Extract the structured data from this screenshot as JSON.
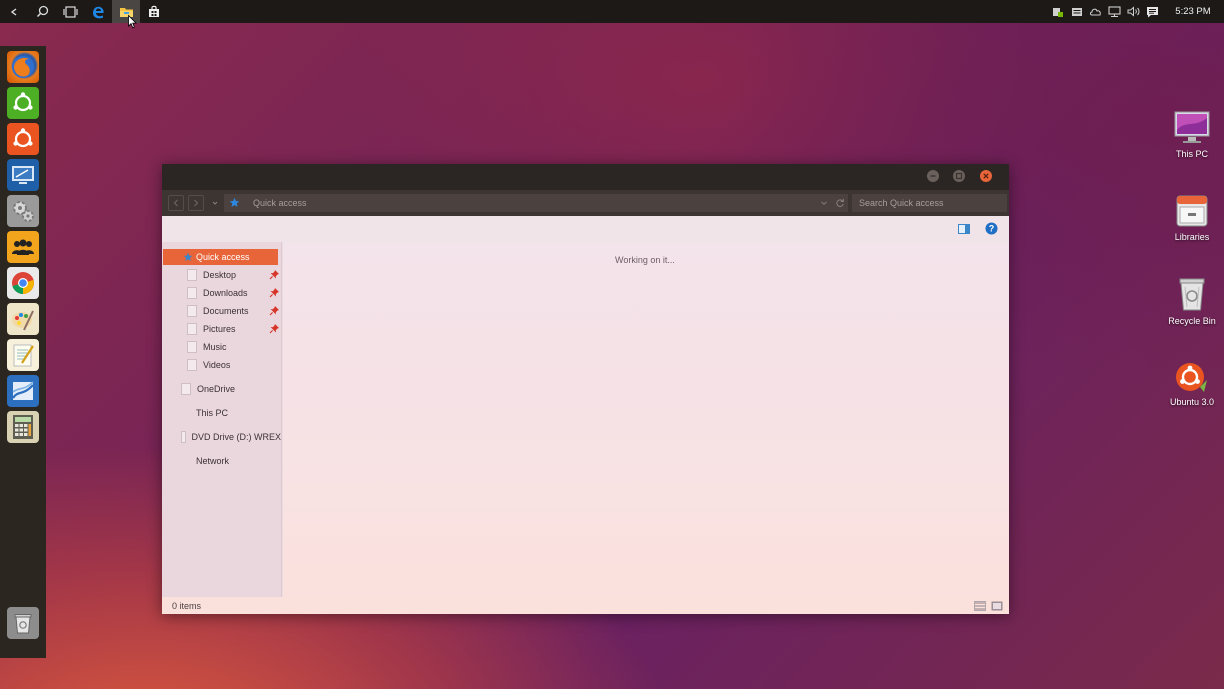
{
  "taskbar": {
    "clock": "5:23 PM",
    "buttons": [
      "back-icon",
      "search-icon",
      "task-view-icon",
      "edge-icon",
      "file-explorer-icon",
      "store-icon"
    ],
    "tray": [
      "nvidia-icon",
      "keyboard-icon",
      "onedrive-icon",
      "network-icon",
      "volume-icon",
      "action-center-icon"
    ]
  },
  "launcher": {
    "apps": [
      "firefox-icon",
      "ubuntu-software-icon",
      "ubuntu-icon",
      "remote-desktop-icon",
      "settings-icon",
      "people-icon",
      "chrome-icon",
      "paint-icon",
      "notepad-icon",
      "sheets-icon",
      "calculator-icon"
    ],
    "trash": "trash-icon"
  },
  "desktop": {
    "icons": [
      {
        "label": "This PC",
        "icon": "monitor-icon"
      },
      {
        "label": "Libraries",
        "icon": "libraries-icon"
      },
      {
        "label": "Recycle Bin",
        "icon": "recycle-bin-icon"
      },
      {
        "label": "Ubuntu 3.0",
        "icon": "ubuntu-logo-icon"
      }
    ]
  },
  "explorer": {
    "address": "Quick access",
    "search_placeholder": "Search Quick access",
    "nav": {
      "quick_access": "Quick access",
      "pinned": [
        "Desktop",
        "Downloads",
        "Documents",
        "Pictures"
      ],
      "unpinned": [
        "Music",
        "Videos"
      ],
      "onedrive": "OneDrive",
      "this_pc": "This PC",
      "dvd": "DVD Drive (D:) WREX",
      "network": "Network"
    },
    "status_message": "Working on it...",
    "item_count": "0 items"
  },
  "colors": {
    "accent": "#e8653a",
    "titlebar": "#2b2523",
    "launcher": "#2b2620",
    "taskbar": "#1c1917"
  }
}
